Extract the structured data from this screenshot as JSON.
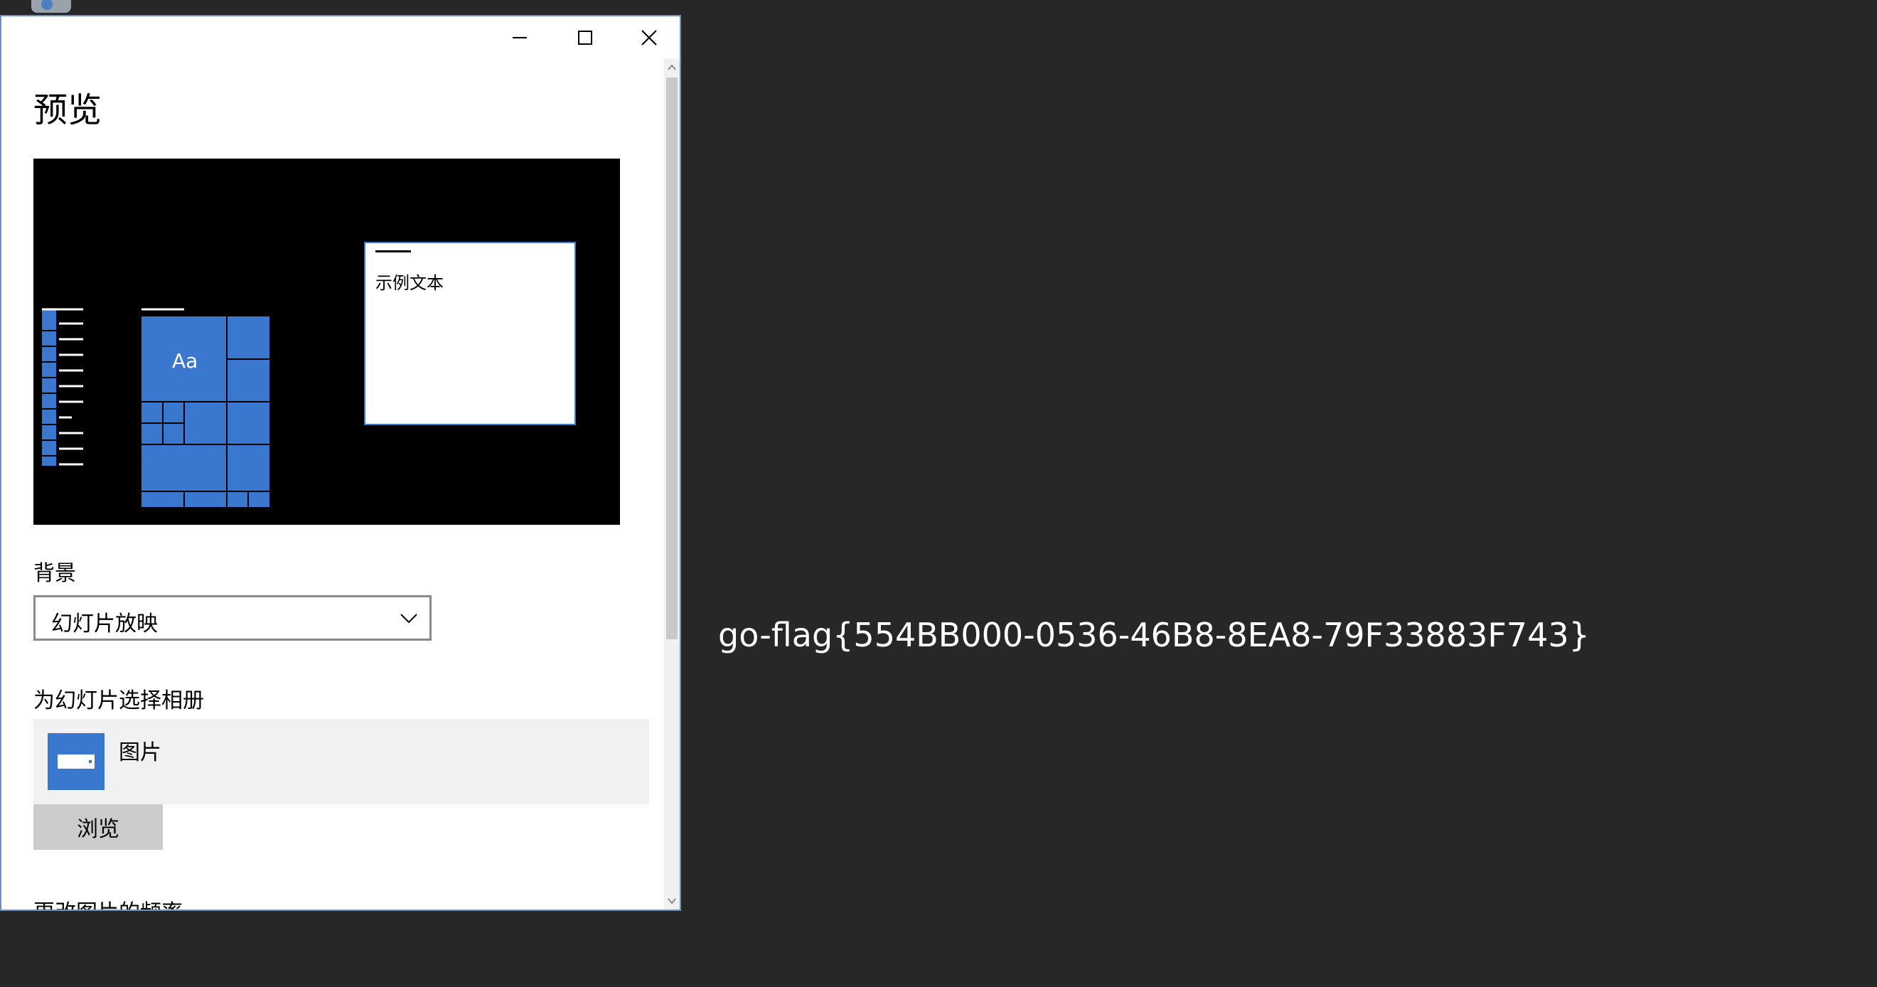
{
  "window": {
    "title": "预览",
    "preview": {
      "sample_text": "示例文本",
      "tile_label": "Aa"
    },
    "background": {
      "label": "背景",
      "selected": "幻灯片放映"
    },
    "album": {
      "label": "为幻灯片选择相册",
      "name": "图片",
      "browse_label": "浏览"
    },
    "frequency_label": "更改图片的频率"
  },
  "desktop": {
    "flag_text": "go-flag{554BB000-0536-46B8-8EA8-79F33883F743}"
  },
  "colors": {
    "accent": "#3a78d0",
    "desktop_bg": "#272727",
    "window_border": "#6f8fbf"
  },
  "icons": [
    "recycle-bin-icon",
    "minimize-icon",
    "maximize-icon",
    "close-icon",
    "chevron-down-icon",
    "image-folder-icon",
    "scroll-up-icon",
    "scroll-down-icon"
  ]
}
